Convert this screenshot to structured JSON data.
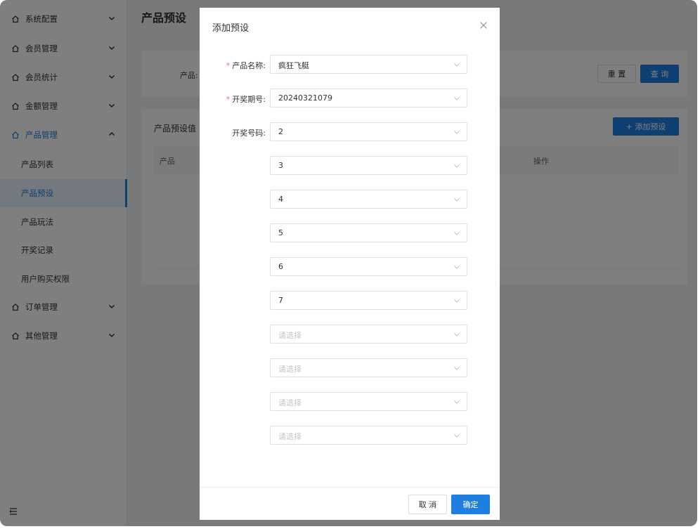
{
  "sidebar": {
    "menus": [
      {
        "label": "系统配置",
        "expanded": false
      },
      {
        "label": "会员管理",
        "expanded": false
      },
      {
        "label": "会员统计",
        "expanded": false
      },
      {
        "label": "金额管理",
        "expanded": false
      },
      {
        "label": "产品管理",
        "expanded": true
      },
      {
        "label": "订单管理",
        "expanded": false
      },
      {
        "label": "其他管理",
        "expanded": false
      }
    ],
    "submenu": [
      {
        "label": "产品列表"
      },
      {
        "label": "产品预设",
        "selected": true
      },
      {
        "label": "产品玩法"
      },
      {
        "label": "开奖记录"
      },
      {
        "label": "用户购买权限"
      }
    ]
  },
  "main": {
    "page_title": "产品预设",
    "filter_label": "产品:",
    "reset_label": "重 置",
    "query_label": "查 询",
    "table_title": "产品预设值",
    "add_label": "+ 添加预设",
    "columns": [
      "产品",
      "操作"
    ]
  },
  "dialog": {
    "title": "添加预设",
    "product_label": "产品名称:",
    "product_value": "疯狂飞艇",
    "period_label": "开奖期号:",
    "period_value": "20240321079",
    "numbers_label": "开奖号码:",
    "numbers": [
      "2",
      "3",
      "4",
      "5",
      "6",
      "7"
    ],
    "placeholder": "请选择",
    "cancel_label": "取 消",
    "confirm_label": "确定"
  },
  "colors": {
    "primary": "#1f7fe0",
    "required": "#f56c6c",
    "mask": "rgba(0,0,0,0.5)"
  }
}
